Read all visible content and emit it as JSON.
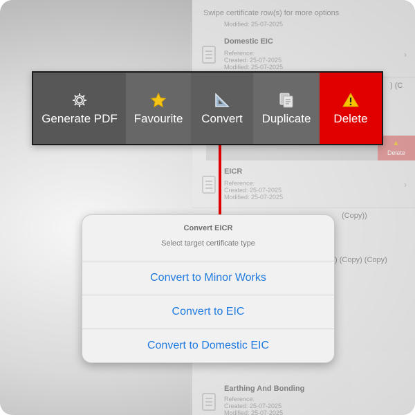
{
  "background": {
    "header": "Swipe certificate row(s) for more options",
    "labels": {
      "reference": "Reference:",
      "created_prefix": "Created: ",
      "modified_prefix": "Modified: "
    },
    "top_meta": "Modified: 25-07-2025",
    "rows": [
      {
        "title": "Domestic EIC",
        "created": "25-07-2025",
        "modified": "25-07-2025"
      },
      {
        "title": "EICR",
        "created": "25-07-2025",
        "modified": "25-07-2025"
      },
      {
        "title": "Earthing And Bonding",
        "created": "25-07-2025",
        "modified": "25-07-2025"
      }
    ],
    "partial_texts": {
      "row_copy_1": ") (C",
      "row_copy_2": "(Copy))",
      "row_copy_3": ") (Copy) (Copy)"
    },
    "swipe_delete_label": "Delete"
  },
  "toolbar": {
    "buttons": [
      {
        "label": "Generate PDF",
        "icon": "gear-icon"
      },
      {
        "label": "Favourite",
        "icon": "star-icon"
      },
      {
        "label": "Convert",
        "icon": "set-square-icon"
      },
      {
        "label": "Duplicate",
        "icon": "duplicate-icon"
      },
      {
        "label": "Delete",
        "icon": "warning-icon"
      }
    ],
    "colors": {
      "delete": "#e10000",
      "connector": "#e00000"
    }
  },
  "sheet": {
    "title": "Convert EICR",
    "subtitle": "Select target certificate type",
    "options": [
      {
        "label": "Convert to Minor Works"
      },
      {
        "label": "Convert to EIC"
      },
      {
        "label": "Convert to Domestic EIC"
      }
    ],
    "accent": "#1f7ae0"
  }
}
